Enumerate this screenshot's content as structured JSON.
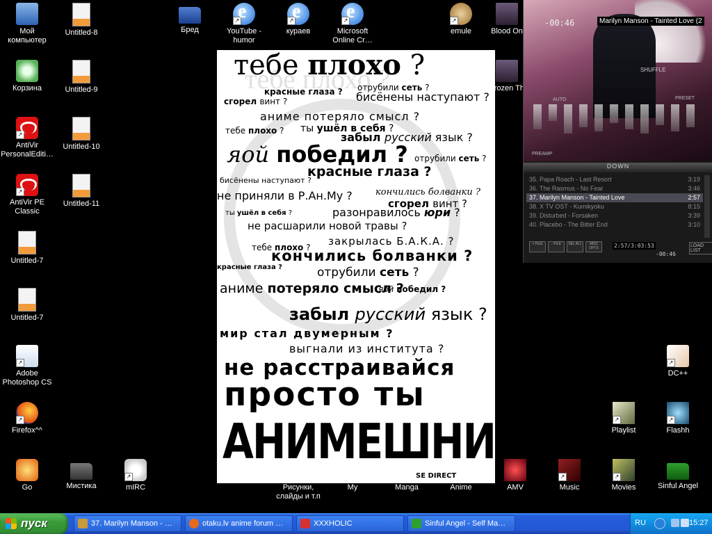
{
  "desktop": {
    "icons": {
      "my_computer": "Мой компьютер",
      "recycle": "Корзина",
      "antivir1": "AntiVir PersonalEditi…",
      "antivir2": "AntiVir PE Classic",
      "untitled7a": "Untitled-7",
      "untitled7b": "Untitled-7",
      "photoshop": "Adobe Photoshop CS",
      "firefox": "Firefox^^",
      "go": "Go",
      "mistika": "Мистика",
      "mirc": "mIRC",
      "untitled8": "Untitled-8",
      "untitled9": "Untitled-9",
      "untitled10": "Untitled-10",
      "untitled11": "Untitled-11",
      "bred": "Бред",
      "youtube": "YouTube - humor",
      "kuraev": "кураев",
      "microsoft": "Microsoft Online Cr…",
      "emule": "emule",
      "blood": "Blood On",
      "frozen": "Frozen Th",
      "risunki": "Рисунки, слайды и т.п",
      "my": "My",
      "manga": "Manga",
      "anime": "Anime",
      "amv": "AMV",
      "music": "Music",
      "movies": "Movies",
      "sinful": "Sinful Angel",
      "dc": "DC++",
      "playlist": "Playlist",
      "flashh": "Flashh"
    }
  },
  "poster": {
    "l1a": "тебе ",
    "l1b": "плохо",
    "l1c": " ?",
    "l2a": "красные глаза ?",
    "l2b": "отрубили ",
    "l2c": "сеть",
    "l2d": " ?",
    "l3a": "сгорел ",
    "l3b": "винт ?",
    "l3c": "бисёнены наступают ?",
    "l4": "аниме потеряло смысл ?",
    "l5a": "тебе ",
    "l5b": "плохо",
    "l5c": " ?",
    "l5d": "ты ",
    "l5e": "ушёл в себя",
    "l5f": " ?",
    "l6a": "забыл ",
    "l6b": "русский",
    "l6c": " язык ?",
    "l7a": "яой ",
    "l7b": "победил ?",
    "l7c": "отрубили ",
    "l7d": "сеть",
    "l7e": " ?",
    "l8": "красные глаза ?",
    "l9": "бисёнены наступают ?",
    "l10a": "не приняли в Р.Ан.Му ?",
    "l10b": "кончились болванки ?",
    "l11a": "сгорел ",
    "l11b": "винт ?",
    "l12a": "ты ",
    "l12b": "ушёл в себя",
    "l12c": " ?",
    "l12d": "разонравилось ",
    "l12e": "юри",
    "l12f": " ?",
    "l13": "не расшарили новой травы ?",
    "l14a": "тебе ",
    "l14b": "плохо",
    "l14c": " ?",
    "l14d": "закрылась Б.А.К.А. ?",
    "l15": "кончились болванки ?",
    "l16a": "красные глаза ?",
    "l16b": "отрубили ",
    "l16c": "сеть",
    "l16d": " ?",
    "l17a": "аниме ",
    "l17b": "потеряло смысл ?",
    "l17c": "яой ",
    "l17d": "победил ?",
    "l18a": "забыл ",
    "l18b": "русский",
    "l18c": " язык ?",
    "l19": "мир стал двумерным ?",
    "l20": "выгнали из института ?",
    "l21": "не расстраивайся",
    "l22": "просто ты",
    "l23": "АНИМЕШНИК",
    "bg_title": "тебе плохо ?",
    "corner": "SE DIRECT"
  },
  "player": {
    "title": "Marilyn Manson - Tainted Love (2",
    "time_digits": "-00:46",
    "shuffle": "SHUFFLE",
    "auto": "AUTO",
    "preset": "PRESET",
    "preamp": "PREAMP",
    "playlist_header": "DOWN",
    "playlist": [
      {
        "n": "35. Papa Roach - Last Resort",
        "t": "3:19"
      },
      {
        "n": "36. The Rasmus - No Fear",
        "t": "3:46"
      },
      {
        "n": "37. Marilyn Manson - Tainted Love",
        "t": "2:57"
      },
      {
        "n": "38. X TV OST - Kumikyoku",
        "t": "8:15"
      },
      {
        "n": "39. Disturbed - Forsaken",
        "t": "3:39"
      },
      {
        "n": "40. Placebo - The Bitter End",
        "t": "3:10"
      }
    ],
    "btn_add": "+ FILE",
    "btn_rem": "- FILE",
    "btn_sel": "SEL ALL",
    "btn_misc": "MISC OPTS",
    "btn_load": "LOAD LIST",
    "pl_time": "2:57/3:03:53",
    "pl_time2": "-00:46"
  },
  "taskbar": {
    "start_label": "пуск",
    "tasks": [
      {
        "label": "37. Marilyn Manson - …",
        "color": "#c89a3a"
      },
      {
        "label": "otaku.lv anime forum …",
        "color": "#e86a1a"
      },
      {
        "label": "XXXHOLIC",
        "color": "#d83030"
      },
      {
        "label": "Sinful Angel - Self Ma…",
        "color": "#2ea02e"
      }
    ],
    "lang": "RU",
    "clock": "15:27"
  }
}
